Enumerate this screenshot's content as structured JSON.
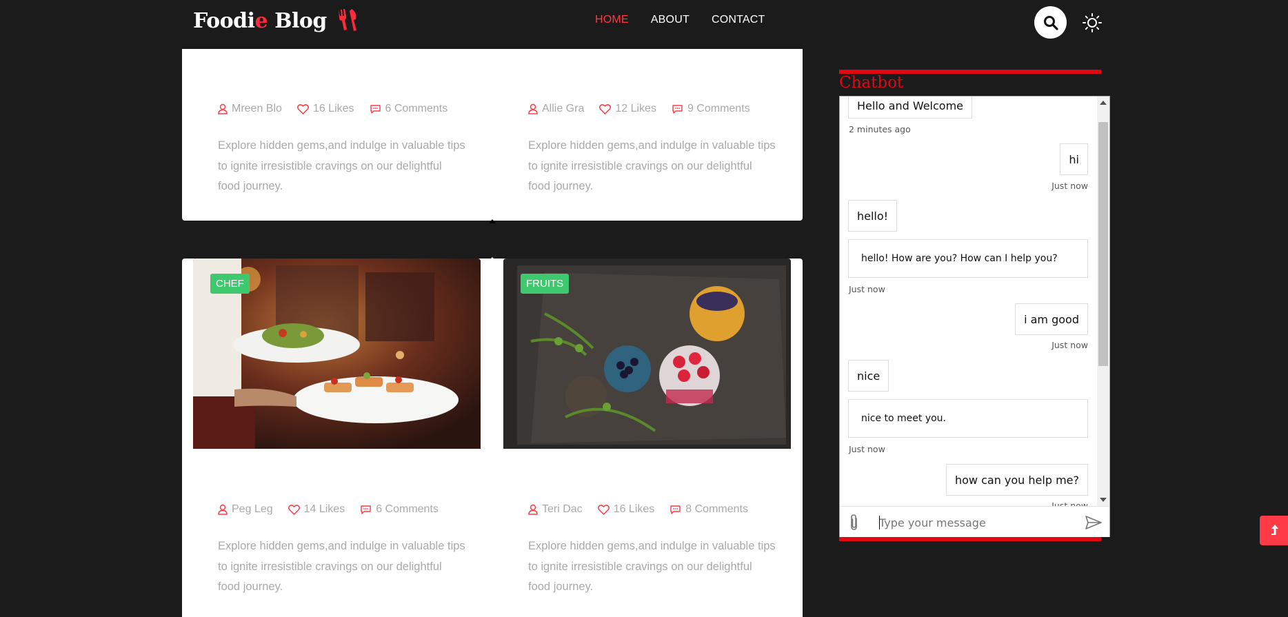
{
  "brand": {
    "name_part1": "Foodi",
    "name_accent": "e",
    "name_part2": " Blog"
  },
  "nav": {
    "items": [
      "HOME",
      "ABOUT",
      "CONTACT"
    ],
    "active": "HOME"
  },
  "colors": {
    "accent": "#ff3a44",
    "tag_green": "#3fc96e",
    "chat_red": "#e30613"
  },
  "posts_top": [
    {
      "author": "Mreen Blo",
      "likes": "16 Likes",
      "comments": "6 Comments",
      "excerpt": "Explore hidden gems,and indulge in valuable tips to ignite irresistible cravings on our delightful food journey."
    },
    {
      "author": "Allie Gra",
      "likes": "12 Likes",
      "comments": "9 Comments",
      "excerpt": "Explore hidden gems,and indulge in valuable tips to ignite irresistible cravings on our delightful food journey."
    }
  ],
  "posts_bottom": [
    {
      "tag": "CHEF",
      "author": "Peg Leg",
      "likes": "14 Likes",
      "comments": "6 Comments",
      "excerpt": "Explore hidden gems,and indulge in valuable tips to ignite irresistible cravings on our delightful food journey."
    },
    {
      "tag": "FRUITS",
      "author": "Teri Dac",
      "likes": "16 Likes",
      "comments": "8 Comments",
      "excerpt": "Explore hidden gems,and indulge in valuable tips to ignite irresistible cravings on our delightful food journey."
    }
  ],
  "chatbot": {
    "title": "Chatbot",
    "messages": [
      {
        "text": "Hello and Welcome"
      },
      {
        "time": "2 minutes ago"
      },
      {
        "text": "hi"
      },
      {
        "time": "Just now"
      },
      {
        "text": "hello!"
      },
      {
        "text": "hello! How are you? How can I help you?"
      },
      {
        "time": "Just now"
      },
      {
        "text": "i am good"
      },
      {
        "time": "Just now"
      },
      {
        "text": "nice"
      },
      {
        "text": "nice to meet you."
      },
      {
        "time": "Just now"
      },
      {
        "text": "how can you help me?"
      },
      {
        "time": "Just now"
      }
    ],
    "input_placeholder": "Type your message"
  },
  "icons": [
    "fork-knife-icon",
    "search-icon",
    "sun-icon",
    "user-icon",
    "heart-icon",
    "comment-icon",
    "paperclip-icon",
    "send-icon",
    "arrow-up-icon"
  ]
}
